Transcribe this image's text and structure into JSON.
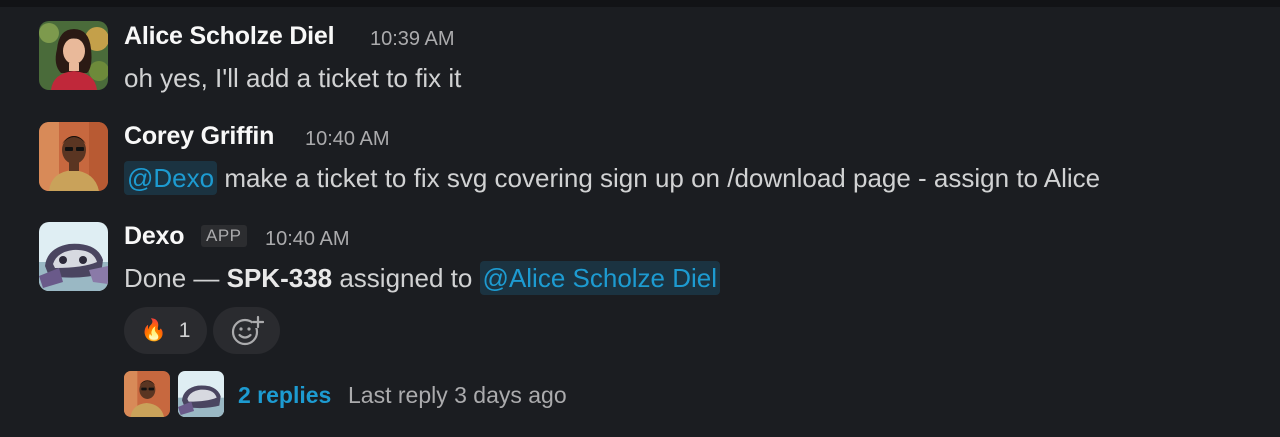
{
  "messages": [
    {
      "author": "Alice Scholze Diel",
      "time": "10:39 AM",
      "text": "oh yes, I'll add a ticket to fix it"
    },
    {
      "author": "Corey Griffin",
      "time": "10:40 AM",
      "mention": "@Dexo",
      "text": " make a ticket to fix svg covering sign up on /download page - assign to Alice"
    },
    {
      "author": "Dexo",
      "badge": "APP",
      "time": "10:40 AM",
      "text_prefix": "Done — ",
      "ticket": "SPK-338",
      "text_middle": " assigned to ",
      "mention": "@Alice Scholze Diel"
    }
  ],
  "reaction": {
    "emoji": "🔥",
    "count": "1",
    "icon": "add-reaction-icon"
  },
  "thread": {
    "replies": "2 replies",
    "last_reply": "Last reply 3 days ago"
  },
  "colors": {
    "background": "#1b1d21",
    "mention": "#1d9bd1",
    "link": "#1d9bd1"
  }
}
